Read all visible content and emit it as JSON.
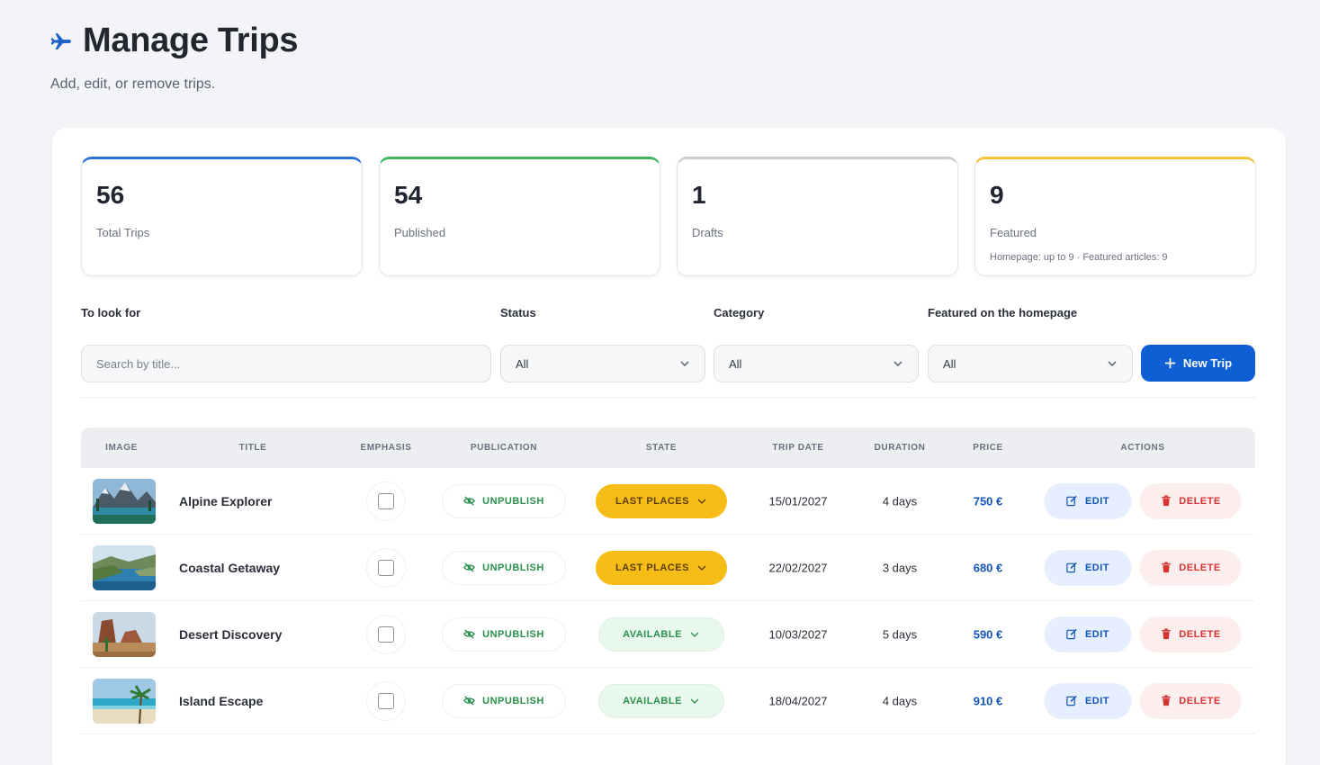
{
  "header": {
    "title": "Manage Trips",
    "subtitle": "Add, edit, or remove trips.",
    "icon": "airplane-icon",
    "icon_color": "#1f63c9"
  },
  "stats": [
    {
      "value": "56",
      "label": "Total Trips",
      "accent": "#2a6fd6"
    },
    {
      "value": "54",
      "label": "Published",
      "accent": "#3fb65a"
    },
    {
      "value": "1",
      "label": "Drafts",
      "accent": "#c8ccd3"
    },
    {
      "value": "9",
      "label": "Featured",
      "note": "Homepage: up to 9 · Featured articles: 9",
      "accent": "#f4c43a"
    }
  ],
  "filters": {
    "search_label": "To look for",
    "search_placeholder": "Search by title...",
    "status_label": "Status",
    "status_value": "All",
    "category_label": "Category",
    "category_value": "All",
    "featured_label": "Featured on the homepage",
    "featured_value": "All",
    "new_button": "New Trip"
  },
  "table": {
    "columns": [
      "IMAGE",
      "TITLE",
      "EMPHASIS",
      "PUBLICATION",
      "STATE",
      "TRIP DATE",
      "DURATION",
      "PRICE",
      "ACTIONS"
    ],
    "rows": [
      {
        "title": "Alpine Explorer",
        "publication": "UNPUBLISH",
        "state": "LAST PLACES",
        "date": "15/01/2027",
        "duration": "4 days",
        "price": "750 €",
        "edit": "EDIT",
        "delete": "DELETE"
      },
      {
        "title": "Coastal Getaway",
        "publication": "UNPUBLISH",
        "state": "LAST PLACES",
        "date": "22/02/2027",
        "duration": "3 days",
        "price": "680 €",
        "edit": "EDIT",
        "delete": "DELETE"
      },
      {
        "title": "Desert Discovery",
        "publication": "UNPUBLISH",
        "state": "AVAILABLE",
        "date": "10/03/2027",
        "duration": "5 days",
        "price": "590 €",
        "edit": "EDIT",
        "delete": "DELETE"
      },
      {
        "title": "Island Escape",
        "publication": "UNPUBLISH",
        "state": "AVAILABLE",
        "date": "18/04/2027",
        "duration": "4 days",
        "price": "910 €",
        "edit": "EDIT",
        "delete": "DELETE"
      }
    ]
  },
  "colors": {
    "primary": "#0f5fd4",
    "last_places": "#f6bd16",
    "available_bg": "#e9f8ec",
    "unpublish_text": "#2a8f4a",
    "delete_text": "#d63434"
  }
}
